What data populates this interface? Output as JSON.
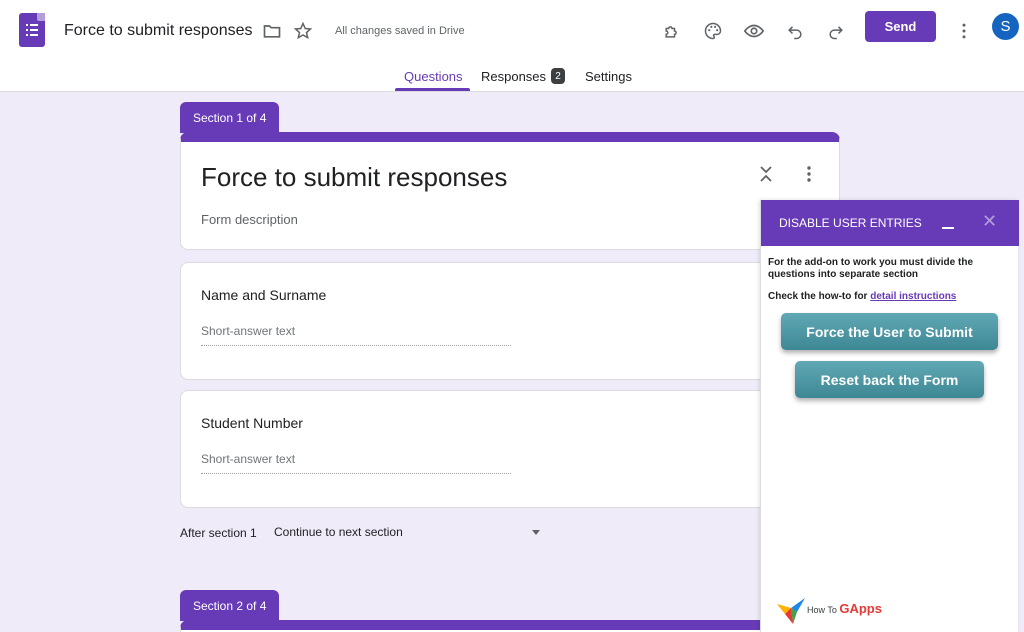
{
  "header": {
    "title": "Force to submit responses",
    "saved_status": "All changes saved in Drive",
    "send_label": "Send",
    "avatar_initial": "S",
    "tabs": [
      {
        "label": "Questions"
      },
      {
        "label": "Responses",
        "badge": "2"
      },
      {
        "label": "Settings"
      }
    ],
    "icons": [
      "folder-icon",
      "star-icon",
      "addon-puzzle-icon",
      "palette-icon",
      "preview-eye-icon",
      "undo-icon",
      "redo-icon",
      "more-vert-icon"
    ]
  },
  "form": {
    "section1_label": "Section 1 of 4",
    "section2_label": "Section 2 of 4",
    "title": "Force to submit responses",
    "description": "Form description",
    "questions": [
      {
        "title": "Name and Surname",
        "placeholder": "Short-answer text"
      },
      {
        "title": "Student Number",
        "placeholder": "Short-answer text"
      }
    ],
    "after_section_label": "After section 1",
    "after_section_value": "Continue to next section"
  },
  "addon": {
    "title": "DISABLE USER ENTRIES",
    "instructions": "For the add-on to work you must divide the questions into separate section",
    "howto_prefix": "Check the how-to for ",
    "howto_link": "detail instructions",
    "force_button": "Force the User to Submit",
    "reset_button": "Reset back the Form",
    "brand_prefix": "How To ",
    "brand_suffix": "GApps"
  },
  "colors": {
    "accent": "#673ab7",
    "background": "#f0ebf8",
    "addon_button": "#4a92a0",
    "avatar": "#1565c0"
  }
}
